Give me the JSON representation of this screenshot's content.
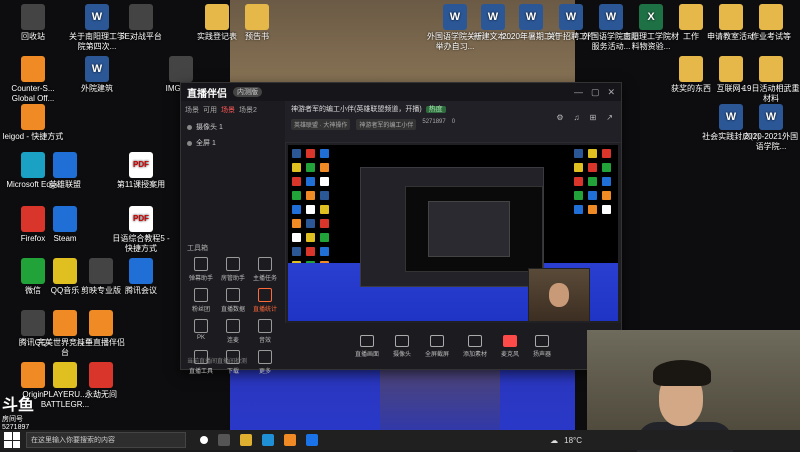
{
  "desktop_icons": [
    {
      "id": "recycle",
      "label": "回收站",
      "kind": "g-app"
    },
    {
      "id": "counter",
      "label": "Counter-S... Global Off...",
      "kind": "g-orange"
    },
    {
      "id": "leigod",
      "label": "leigod - 快捷方式",
      "kind": "g-orange"
    },
    {
      "id": "edge",
      "label": "Microsoft Edge",
      "kind": "g-teal"
    },
    {
      "id": "firefox",
      "label": "Firefox",
      "kind": "g-red"
    },
    {
      "id": "wechat",
      "label": "微信",
      "kind": "g-green"
    },
    {
      "id": "tencentqq",
      "label": "腾讯QQ",
      "kind": "g-app"
    },
    {
      "id": "origin",
      "label": "Origin",
      "kind": "g-orange"
    },
    {
      "id": "doc1",
      "label": "关于南阳理工学院第四次...",
      "kind": "g-word"
    },
    {
      "id": "waijiao",
      "label": "外院建筑",
      "kind": "g-word"
    },
    {
      "id": "lol",
      "label": "英雄联盟",
      "kind": "g-blue"
    },
    {
      "id": "steam",
      "label": "Steam",
      "kind": "g-blue"
    },
    {
      "id": "qqmusic",
      "label": "QQ音乐",
      "kind": "g-yellow"
    },
    {
      "id": "pubg",
      "label": "PLAYERU... BATTLEGR...",
      "kind": "g-yellow"
    },
    {
      "id": "wanmei",
      "label": "完美世界竞技平台",
      "kind": "g-orange"
    },
    {
      "id": "5e",
      "label": "5E对战平台",
      "kind": "g-app"
    },
    {
      "id": "pdf1",
      "label": "第11课授案用",
      "kind": "g-pdf"
    },
    {
      "id": "pdf2",
      "label": "日语综合教程5 - 快捷方式",
      "kind": "g-pdf"
    },
    {
      "id": "capcut",
      "label": "剪映专业版",
      "kind": "g-app"
    },
    {
      "id": "tencentmeet",
      "label": "腾讯会议",
      "kind": "g-blue"
    },
    {
      "id": "douyu",
      "label": "斗鱼直播伴侣",
      "kind": "g-orange"
    },
    {
      "id": "yongjie",
      "label": "永劫无间",
      "kind": "g-red"
    },
    {
      "id": "img",
      "label": "IMG_2...",
      "kind": "g-app"
    },
    {
      "id": "shiyan",
      "label": "实践登记表",
      "kind": "g-zip"
    },
    {
      "id": "yugao",
      "label": "预告书",
      "kind": "g-zip"
    },
    {
      "id": "waiguo1",
      "label": "外国语学院关于举办自习...",
      "kind": "g-word"
    },
    {
      "id": "xinjian",
      "label": "新建文本...",
      "kind": "g-word"
    },
    {
      "id": "gongzuo",
      "label": "2020年暑期工作",
      "kind": "g-word"
    },
    {
      "id": "zhaopin",
      "label": "关于招聘工作",
      "kind": "g-word"
    },
    {
      "id": "waiguo2",
      "label": "外国语学院志愿服务活动...",
      "kind": "g-word"
    },
    {
      "id": "nanyang",
      "label": "南阳理工学院材料物资验...",
      "kind": "g-excel"
    },
    {
      "id": "work",
      "label": "工作",
      "kind": "g-zip"
    },
    {
      "id": "shenqing",
      "label": "申请教室活动",
      "kind": "g-zip"
    },
    {
      "id": "zuoye",
      "label": "作业考试等",
      "kind": "g-zip"
    },
    {
      "id": "huode",
      "label": "获奖的东西",
      "kind": "g-zip"
    },
    {
      "id": "hulian",
      "label": "互联网+",
      "kind": "g-zip"
    },
    {
      "id": "19ri",
      "label": "19日活动相武重材料",
      "kind": "g-zip"
    },
    {
      "id": "shehui",
      "label": "社会实践封皮(1)",
      "kind": "g-word"
    },
    {
      "id": "2020",
      "label": "2020-2021外国语学院...",
      "kind": "g-word"
    }
  ],
  "app": {
    "title": "直播伴侣",
    "version_badge": "内测版",
    "window_controls": [
      "—",
      "▢",
      "✕"
    ],
    "scene_tabs": [
      "场景",
      "可用",
      "场景",
      "场景2"
    ],
    "active_scene_tab": 2,
    "sources": [
      "摄像头 1",
      "全屏 1"
    ],
    "tools_label": "工具箱",
    "tools": [
      {
        "label": "弹幕助手",
        "hot": false
      },
      {
        "label": "房管助手",
        "hot": false
      },
      {
        "label": "主播任务",
        "hot": false
      },
      {
        "label": "粉丝团",
        "hot": false
      },
      {
        "label": "直播数据",
        "hot": false
      },
      {
        "label": "直播统计",
        "hot": true
      },
      {
        "label": "PK",
        "hot": false
      },
      {
        "label": "连麦",
        "hot": false
      },
      {
        "label": "音效",
        "hot": false
      },
      {
        "label": "直播工具",
        "hot": false
      },
      {
        "label": "下载",
        "hot": false
      },
      {
        "label": "更多",
        "hot": false
      }
    ],
    "bottom_hint": "当前直播间直播间检测",
    "room_title": "神游者军的编工小伴(英雄联盟频道，开播)",
    "room_tag": "热度",
    "room_category": "英雄联盟 · 大神操作",
    "room_name": "神游者军的编工小伴",
    "room_id": "5271897",
    "room_count": "0",
    "top_icons": [
      "⚙",
      "♫",
      "⊞",
      "↗"
    ],
    "controls": [
      {
        "label": "直播画面",
        "mic": false
      },
      {
        "label": "摄像头",
        "mic": false
      },
      {
        "label": "全屏截屏",
        "mic": false
      },
      {
        "label": "添加素材",
        "mic": false
      },
      {
        "label": "麦克风",
        "mic": true
      },
      {
        "label": "扬声器",
        "mic": false
      }
    ]
  },
  "overlay_logo": {
    "brand": "斗鱼",
    "sub": "房间号",
    "room": "5271897"
  },
  "taskbar": {
    "search_placeholder": "在这里输入你要搜索的内容",
    "weather": "18°C",
    "clock": "☁"
  }
}
